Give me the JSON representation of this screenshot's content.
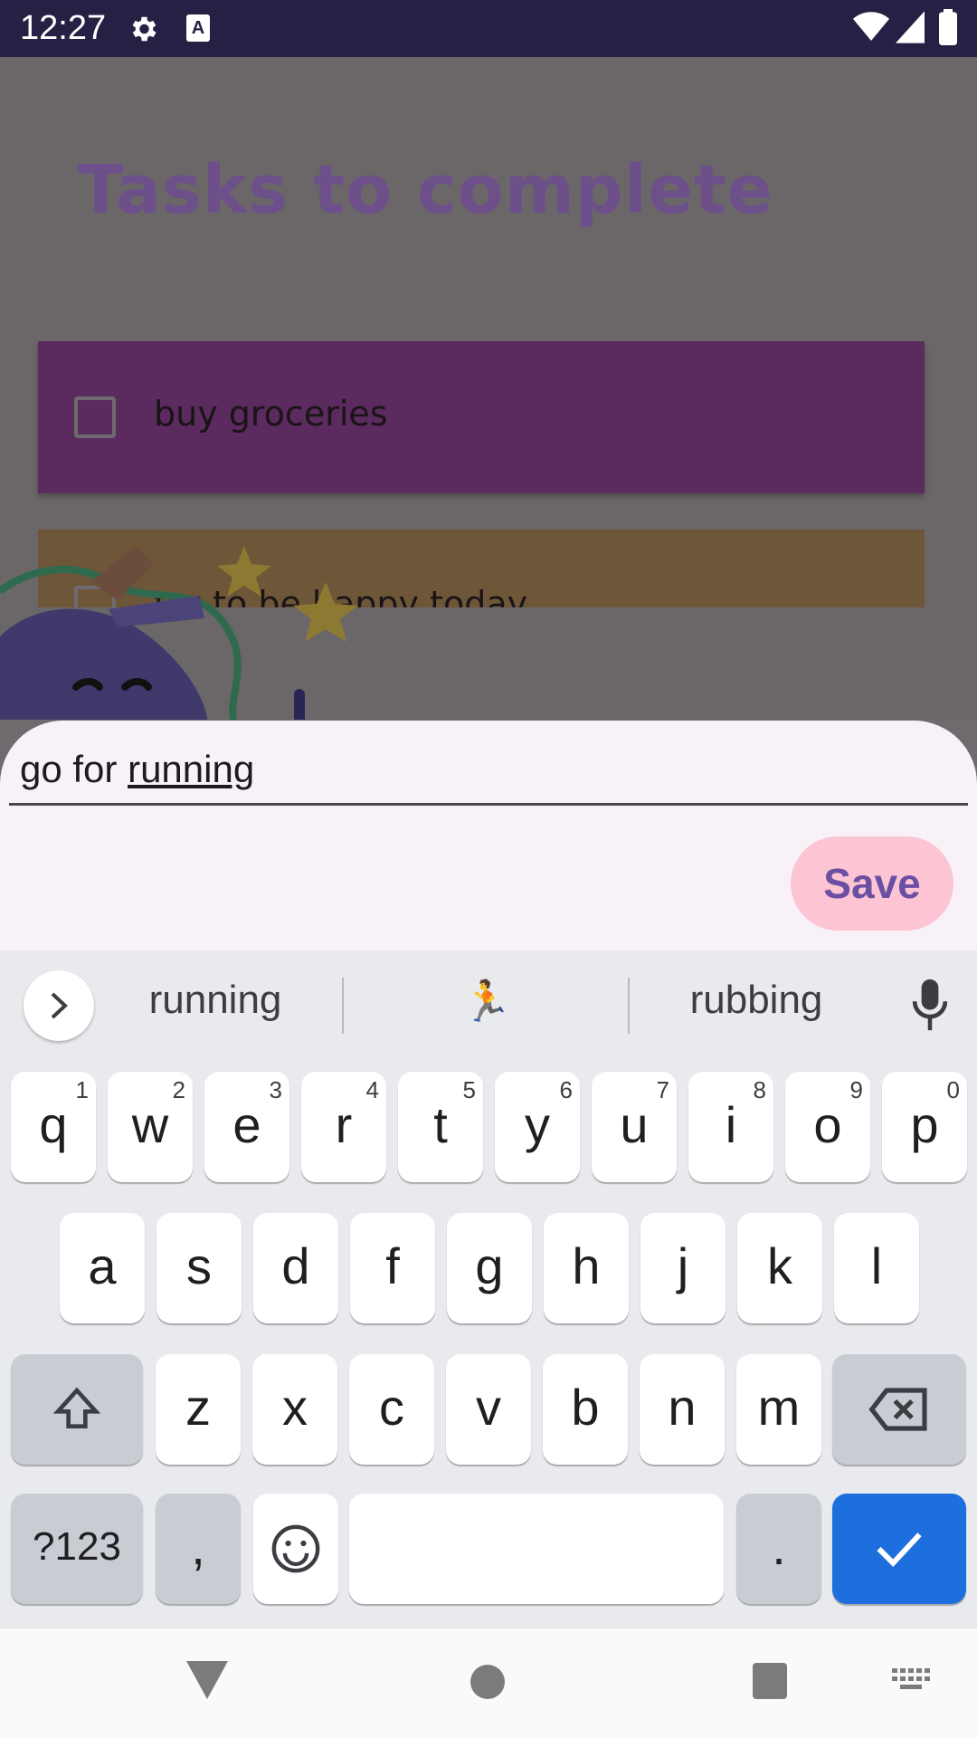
{
  "status_bar": {
    "time": "12:27",
    "icons": [
      "gear-icon",
      "a-icon",
      "wifi-icon",
      "signal-icon",
      "battery-icon"
    ]
  },
  "app": {
    "title": "Tasks to complete",
    "tasks": [
      {
        "label": "buy groceries",
        "checked": false,
        "color": "#5b2a5e"
      },
      {
        "label": "try to be happy today",
        "checked": false,
        "color": "#6e5638"
      }
    ]
  },
  "sheet": {
    "input_prefix": "go for ",
    "input_composing": "running",
    "save_label": "Save"
  },
  "keyboard": {
    "suggestions": [
      "running",
      "🏃",
      "rubbing"
    ],
    "row1": [
      {
        "k": "q",
        "h": "1"
      },
      {
        "k": "w",
        "h": "2"
      },
      {
        "k": "e",
        "h": "3"
      },
      {
        "k": "r",
        "h": "4"
      },
      {
        "k": "t",
        "h": "5"
      },
      {
        "k": "y",
        "h": "6"
      },
      {
        "k": "u",
        "h": "7"
      },
      {
        "k": "i",
        "h": "8"
      },
      {
        "k": "o",
        "h": "9"
      },
      {
        "k": "p",
        "h": "0"
      }
    ],
    "row2": [
      "a",
      "s",
      "d",
      "f",
      "g",
      "h",
      "j",
      "k",
      "l"
    ],
    "row3": [
      "z",
      "x",
      "c",
      "v",
      "b",
      "n",
      "m"
    ],
    "symbols_label": "?123",
    "comma_label": ",",
    "period_label": ".",
    "accent_color": "#1d6fdd"
  }
}
